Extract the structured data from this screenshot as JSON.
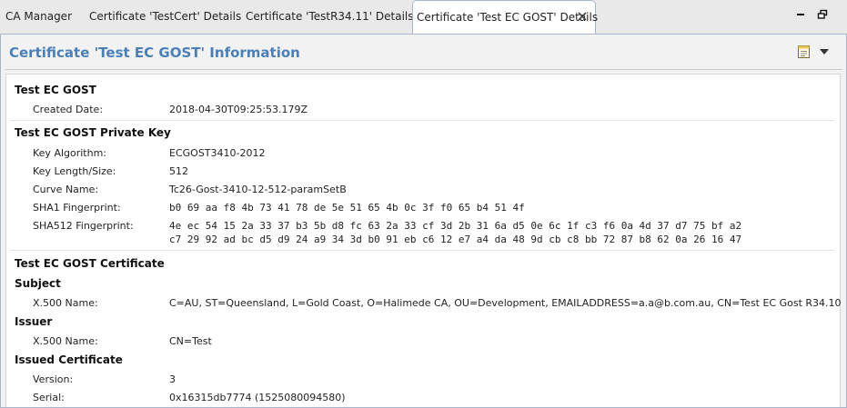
{
  "tabs": [
    {
      "label": "CA Manager",
      "active": false
    },
    {
      "label": "Certificate 'TestCert' Details",
      "active": false
    },
    {
      "label": "Certificate 'TestR34.11' Details",
      "active": false
    },
    {
      "label": "Certificate 'Test EC GOST' Details",
      "active": true
    }
  ],
  "window_controls": {
    "minimize": "minimize-icon",
    "maximize": "restore-icon"
  },
  "panel": {
    "title": "Certificate 'Test EC GOST' Information",
    "tools": [
      "notes-icon",
      "dropdown-arrow-icon"
    ]
  },
  "sections": {
    "general": {
      "title": "Test EC GOST",
      "created_label": "Created Date:",
      "created_value": "2018-04-30T09:25:53.179Z"
    },
    "private_key": {
      "title": "Test EC GOST Private Key",
      "algorithm_label": "Key Algorithm:",
      "algorithm_value": "ECGOST3410-2012",
      "size_label": "Key Length/Size:",
      "size_value": "512",
      "curve_label": "Curve Name:",
      "curve_value": "Tc26-Gost-3410-12-512-paramSetB",
      "sha1_label": "SHA1 Fingerprint:",
      "sha1_value": "b0 69 aa f8 4b 73 41 78 de 5e 51 65 4b 0c 3f f0 65 b4 51 4f",
      "sha512_label": "SHA512 Fingerprint:",
      "sha512_line1": "4e ec 54 15 2a 33 37 b3 5b d8 fc 63 2a 33 cf 3d 2b 31 6a d5 0e 6c 1f c3 f6 0a 4d 37 d7 75 bf a2",
      "sha512_line2": "c7 29 92 ad bc d5 d9 24 a9 34 3d b0 91 eb c6 12 e7 a4 da 48 9d cb c8 bb 72 87 b8 62 0a 26 16 47"
    },
    "certificate": {
      "title": "Test EC GOST Certificate",
      "subject_title": "Subject",
      "subject_x500_label": "X.500 Name:",
      "subject_x500_value": "C=AU, ST=Queensland, L=Gold Coast, O=Halimede CA, OU=Development, EMAILADDRESS=a.a@b.com.au, CN=Test EC Gost R34.10",
      "issuer_title": "Issuer",
      "issuer_x500_label": "X.500 Name:",
      "issuer_x500_value": "CN=Test",
      "issued_title": "Issued Certificate",
      "version_label": "Version:",
      "version_value": "3",
      "serial_label": "Serial:",
      "serial_value": "0x16315db7774 (1525080094580)"
    }
  }
}
